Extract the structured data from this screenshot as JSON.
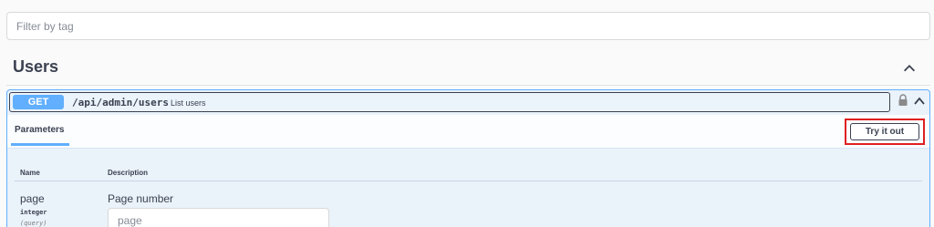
{
  "filter": {
    "placeholder": "Filter by tag"
  },
  "tag": {
    "title": "Users",
    "icon": "chevron-up-icon"
  },
  "operation": {
    "method": "GET",
    "path": "/api/admin/users",
    "summary": "List users",
    "method_color": "#61affe",
    "lock_icon": "lock-icon",
    "collapse_icon": "chevron-up-icon"
  },
  "parameters_section": {
    "tab_label": "Parameters",
    "try_button_label": "Try it out",
    "highlight_color": "#e02020"
  },
  "params_table": {
    "headers": {
      "name": "Name",
      "description": "Description"
    },
    "rows": [
      {
        "name": "page",
        "type": "integer",
        "in": "(query)",
        "description": "Page number",
        "placeholder": "page"
      }
    ]
  }
}
